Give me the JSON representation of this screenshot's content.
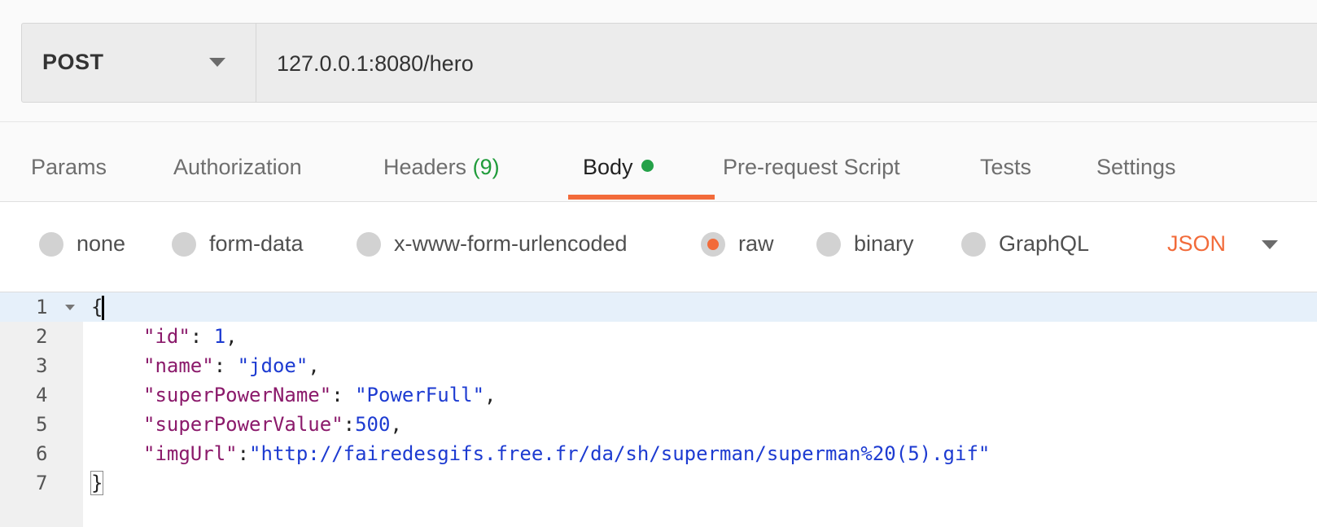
{
  "request": {
    "method": "POST",
    "url": "127.0.0.1:8080/hero"
  },
  "tabs": [
    {
      "label": "Params"
    },
    {
      "label": "Authorization"
    },
    {
      "label": "Headers",
      "count": "(9)"
    },
    {
      "label": "Body",
      "active": true
    },
    {
      "label": "Pre-request Script"
    },
    {
      "label": "Tests"
    },
    {
      "label": "Settings"
    }
  ],
  "body_types": [
    {
      "label": "none",
      "checked": false
    },
    {
      "label": "form-data",
      "checked": false
    },
    {
      "label": "x-www-form-urlencoded",
      "checked": false
    },
    {
      "label": "raw",
      "checked": true
    },
    {
      "label": "binary",
      "checked": false
    },
    {
      "label": "GraphQL",
      "checked": false
    }
  ],
  "format": "JSON",
  "colors": {
    "accent": "#f26b3a",
    "success": "#24a148",
    "json_key": "#8b1a6b",
    "json_value": "#1d3bd1"
  },
  "editor": {
    "line_numbers": [
      "1",
      "2",
      "3",
      "4",
      "5",
      "6",
      "7"
    ],
    "lines": [
      {
        "open": "{"
      },
      {
        "key": "\"id\"",
        "sep": ": ",
        "value": "1",
        "end": ","
      },
      {
        "key": "\"name\"",
        "sep": ": ",
        "value": "\"jdoe\"",
        "end": ","
      },
      {
        "key": "\"superPowerName\"",
        "sep": ": ",
        "value": "\"PowerFull\"",
        "end": ","
      },
      {
        "key": "\"superPowerValue\"",
        "sep": ":",
        "value": "500",
        "end": ","
      },
      {
        "key": "\"imgUrl\"",
        "sep": ":",
        "value": "\"http://fairedesgifs.free.fr/da/sh/superman/superman%20(5).gif\"",
        "end": ""
      },
      {
        "close": "}"
      }
    ]
  }
}
